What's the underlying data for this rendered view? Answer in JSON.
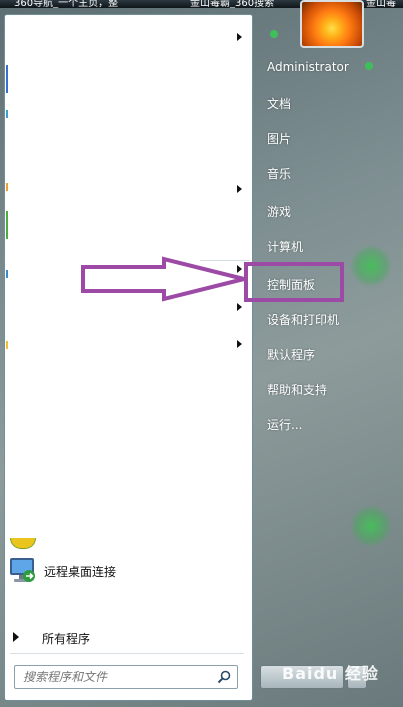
{
  "taskbar": {
    "tabs": [
      "360导航_一个主页，整",
      "金山毒霸_360搜索",
      "金山毒"
    ]
  },
  "left_pane": {
    "remote_desktop_label": "远程桌面连接",
    "all_programs_label": "所有程序",
    "search": {
      "placeholder": "搜索程序和文件",
      "value": ""
    }
  },
  "right_pane": {
    "user_name": "Administrator",
    "items": [
      "文档",
      "图片",
      "音乐",
      "游戏",
      "计算机",
      "控制面板",
      "设备和打印机",
      "默认程序",
      "帮助和支持",
      "运行..."
    ],
    "highlighted_item": "控制面板"
  },
  "annotation": {
    "color": "#9c4aa5"
  },
  "watermark": "Baidu 经验",
  "icons": {
    "search": "search-icon",
    "remote_desktop": "remote-desktop-icon",
    "all_programs": "triangle-right-icon",
    "user_picture": "user-flower-icon",
    "arrow": "arrow-right-icon"
  }
}
